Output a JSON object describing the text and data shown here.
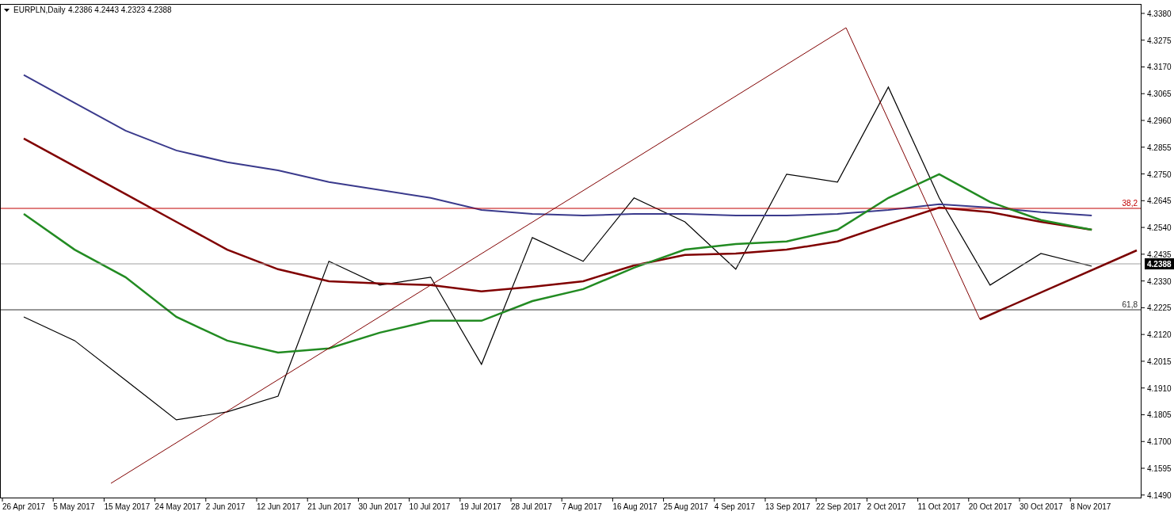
{
  "chart_header": {
    "symbol": "EURPLN,Daily",
    "ohlc": "4.2386 4.2443 4.2323 4.2388"
  },
  "chart": {
    "chart_data": {
      "type": "line",
      "categories": [
        "26 Apr 2017",
        "5 May 2017",
        "15 May 2017",
        "24 May 2017",
        "2 Jun 2017",
        "12 Jun 2017",
        "21 Jun 2017",
        "30 Jun 2017",
        "10 Jul 2017",
        "19 Jul 2017",
        "28 Jul 2017",
        "7 Aug 2017",
        "16 Aug 2017",
        "25 Aug 2017",
        "4 Sep 2017",
        "13 Sep 2017",
        "22 Sep 2017",
        "2 Oct 2017",
        "11 Oct 2017",
        "20 Oct 2017",
        "30 Oct 2017",
        "8 Nov 2017"
      ],
      "series": [
        {
          "color": "#000000",
          "values": [
            4.2189,
            4.2096,
            4.1941,
            4.1785,
            4.1816,
            4.1878,
            4.2407,
            4.2314,
            4.2345,
            4.2003,
            4.25,
            4.2407,
            4.2656,
            4.2562,
            4.2376,
            4.2749,
            4.2718,
            4.3091,
            4.2656,
            4.2314,
            4.2438,
            4.2388
          ]
        },
        {
          "color": "#3a3a8c",
          "values": [
            4.3138,
            4.3029,
            4.292,
            4.2842,
            4.2796,
            4.2764,
            4.2718,
            4.2687,
            4.2656,
            4.2609,
            4.2593,
            4.2587,
            4.2593,
            4.2593,
            4.2587,
            4.2587,
            4.2593,
            4.2609,
            4.2631,
            4.2618,
            4.26,
            4.2587
          ]
        },
        {
          "color": "#800000",
          "values": [
            4.2889,
            4.278,
            4.2671,
            4.2562,
            4.2453,
            4.2376,
            4.2329,
            4.232,
            4.2314,
            4.2289,
            4.2307,
            4.2329,
            4.2391,
            4.2432,
            4.2438,
            4.2453,
            4.2485,
            4.2553,
            4.2618,
            4.26,
            4.2562,
            4.2531
          ]
        },
        {
          "color": "#228b22",
          "values": [
            4.2593,
            4.2453,
            4.2345,
            4.2189,
            4.2096,
            4.2049,
            4.2065,
            4.2127,
            4.2174,
            4.2174,
            4.2251,
            4.2298,
            4.2382,
            4.2453,
            4.2475,
            4.2485,
            4.2531,
            4.2656,
            4.2749,
            4.264,
            4.2569,
            4.2531
          ]
        }
      ],
      "ylim": [
        4.148,
        4.3417
      ],
      "yticks": [
        {
          "value": 4.338,
          "label": "4.3380"
        },
        {
          "value": 4.3275,
          "label": "4.3275"
        },
        {
          "value": 4.317,
          "label": "4.3170"
        },
        {
          "value": 4.3065,
          "label": "4.3065"
        },
        {
          "value": 4.296,
          "label": "4.2960"
        },
        {
          "value": 4.2855,
          "label": "4.2855"
        },
        {
          "value": 4.275,
          "label": "4.2750"
        },
        {
          "value": 4.2645,
          "label": "4.2645"
        },
        {
          "value": 4.254,
          "label": "4.2540"
        },
        {
          "value": 4.2435,
          "label": "4.2435"
        },
        {
          "value": 4.233,
          "label": "4.2330"
        },
        {
          "value": 4.2225,
          "label": "4.2225"
        },
        {
          "value": 4.212,
          "label": "4.2120"
        },
        {
          "value": 4.2015,
          "label": "4.2015"
        },
        {
          "value": 4.191,
          "label": "4.1910"
        },
        {
          "value": 4.1805,
          "label": "4.1805"
        },
        {
          "value": 4.17,
          "label": "4.1700"
        },
        {
          "value": 4.1595,
          "label": "4.1595"
        },
        {
          "value": 4.149,
          "label": "4.1490"
        }
      ]
    }
  },
  "fibonacci_levels": [
    {
      "label": "38,2"
    },
    {
      "label": "61,8"
    }
  ],
  "current_price": {
    "label": "4.2388"
  }
}
